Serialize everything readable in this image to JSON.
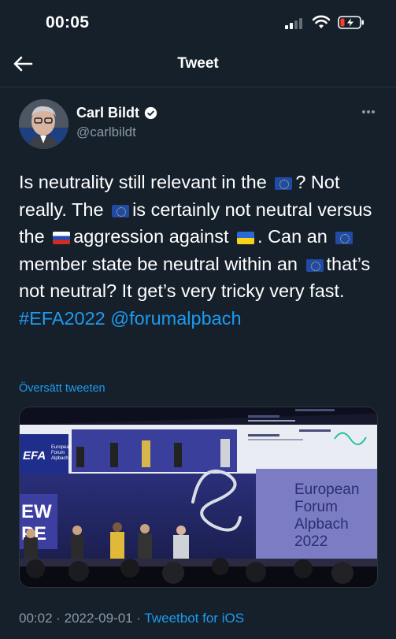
{
  "status_bar": {
    "time": "00:05"
  },
  "nav": {
    "title": "Tweet"
  },
  "tweet": {
    "user_name": "Carl Bildt",
    "handle": "@carlbildt",
    "text_parts": {
      "p1": "Is neutrality still relevant in the",
      "p2": "? Not really. The",
      "p3": "is certainly not neutral versus the",
      "p4": "aggression against",
      "p5": ". Can an",
      "p6": "member state be neutral within an",
      "p7": "that’s not neutral? It get’s very tricky very fast.",
      "hashtag": "#EFA2022",
      "mention": "@forumalpbach"
    },
    "flags": [
      "eu-flag",
      "eu-flag",
      "russia-flag",
      "ukraine-flag",
      "eu-flag",
      "eu-flag"
    ],
    "translate_label": "Översätt tweeten",
    "photo": {
      "screen_brand": "EFA",
      "screen_brand_sub": [
        "European",
        "Forum",
        "Alpbach"
      ],
      "panel_text": [
        "European",
        "Forum",
        "Alpbach",
        "2022"
      ]
    },
    "timestamp": "00:02 · 2022-09-01 · ",
    "source": "Tweetbot for iOS"
  },
  "colors": {
    "background": "#15202b",
    "accent": "#1d9bf0",
    "secondary_text": "#8b98a5"
  }
}
